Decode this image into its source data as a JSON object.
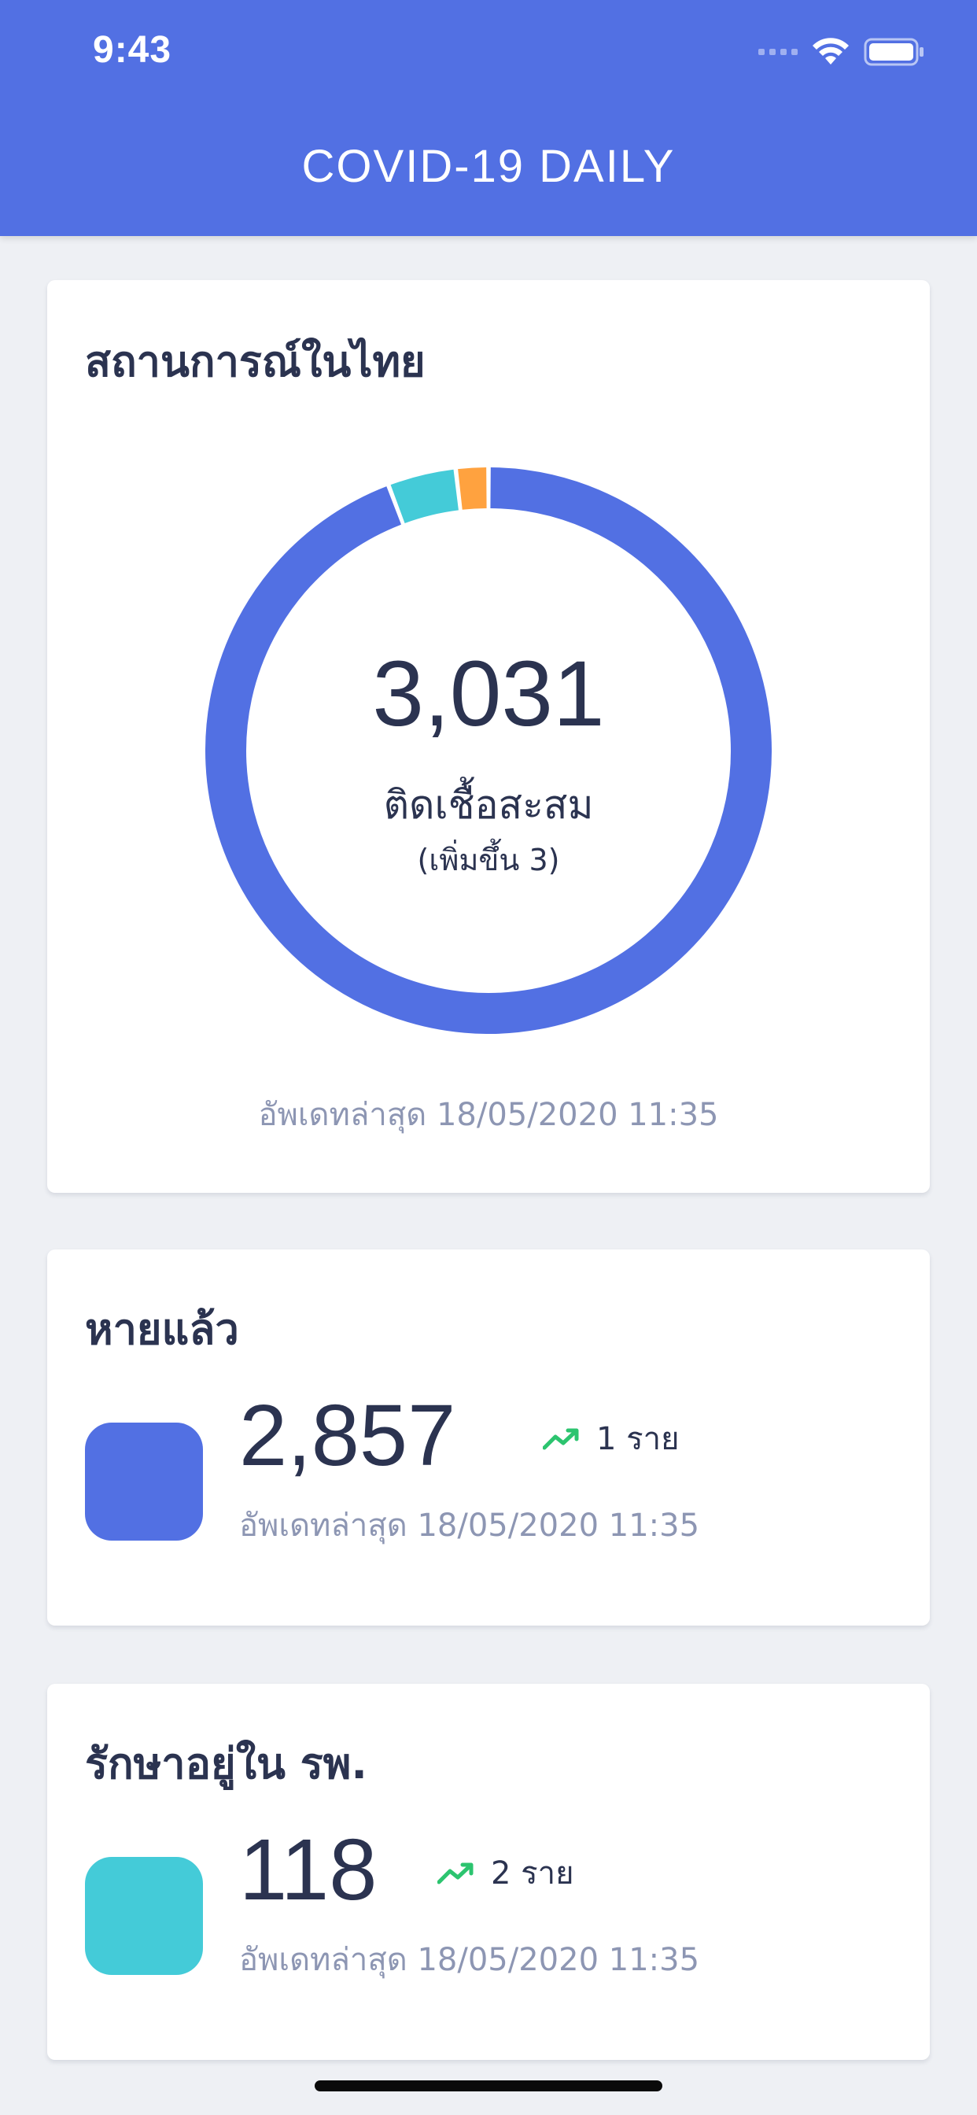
{
  "status_bar": {
    "time": "9:43"
  },
  "header": {
    "title": "COVID-19 DAILY",
    "background_color": "#5270e3"
  },
  "summary": {
    "title": "สถานการณ์ในไทย",
    "total": "3,031",
    "total_label": "ติดเชื้อสะสม",
    "total_increase": "(เพิ่มขึ้น 3)",
    "updated": "อัพเดทล่าสุด 18/05/2020 11:35",
    "donut": {
      "segments": [
        {
          "key": "recovered",
          "value": 2857,
          "color": "#5270e3"
        },
        {
          "key": "hospitalized",
          "value": 118,
          "color": "#44cbd8"
        },
        {
          "key": "deaths",
          "value": 56,
          "color": "#ffa23f"
        }
      ]
    }
  },
  "recovered": {
    "title": "หายแล้ว",
    "value": "2,857",
    "change": "1 ราย",
    "change_icon": "trending-up-icon",
    "updated": "อัพเดทล่าสุด 18/05/2020 11:35",
    "color": "#5270e3"
  },
  "hospitalized": {
    "title": "รักษาอยู่ใน รพ.",
    "value": "118",
    "change": "2 ราย",
    "change_icon": "trending-up-icon",
    "updated": "อัพเดทล่าสุด 18/05/2020 11:35",
    "color": "#44cbd8"
  }
}
